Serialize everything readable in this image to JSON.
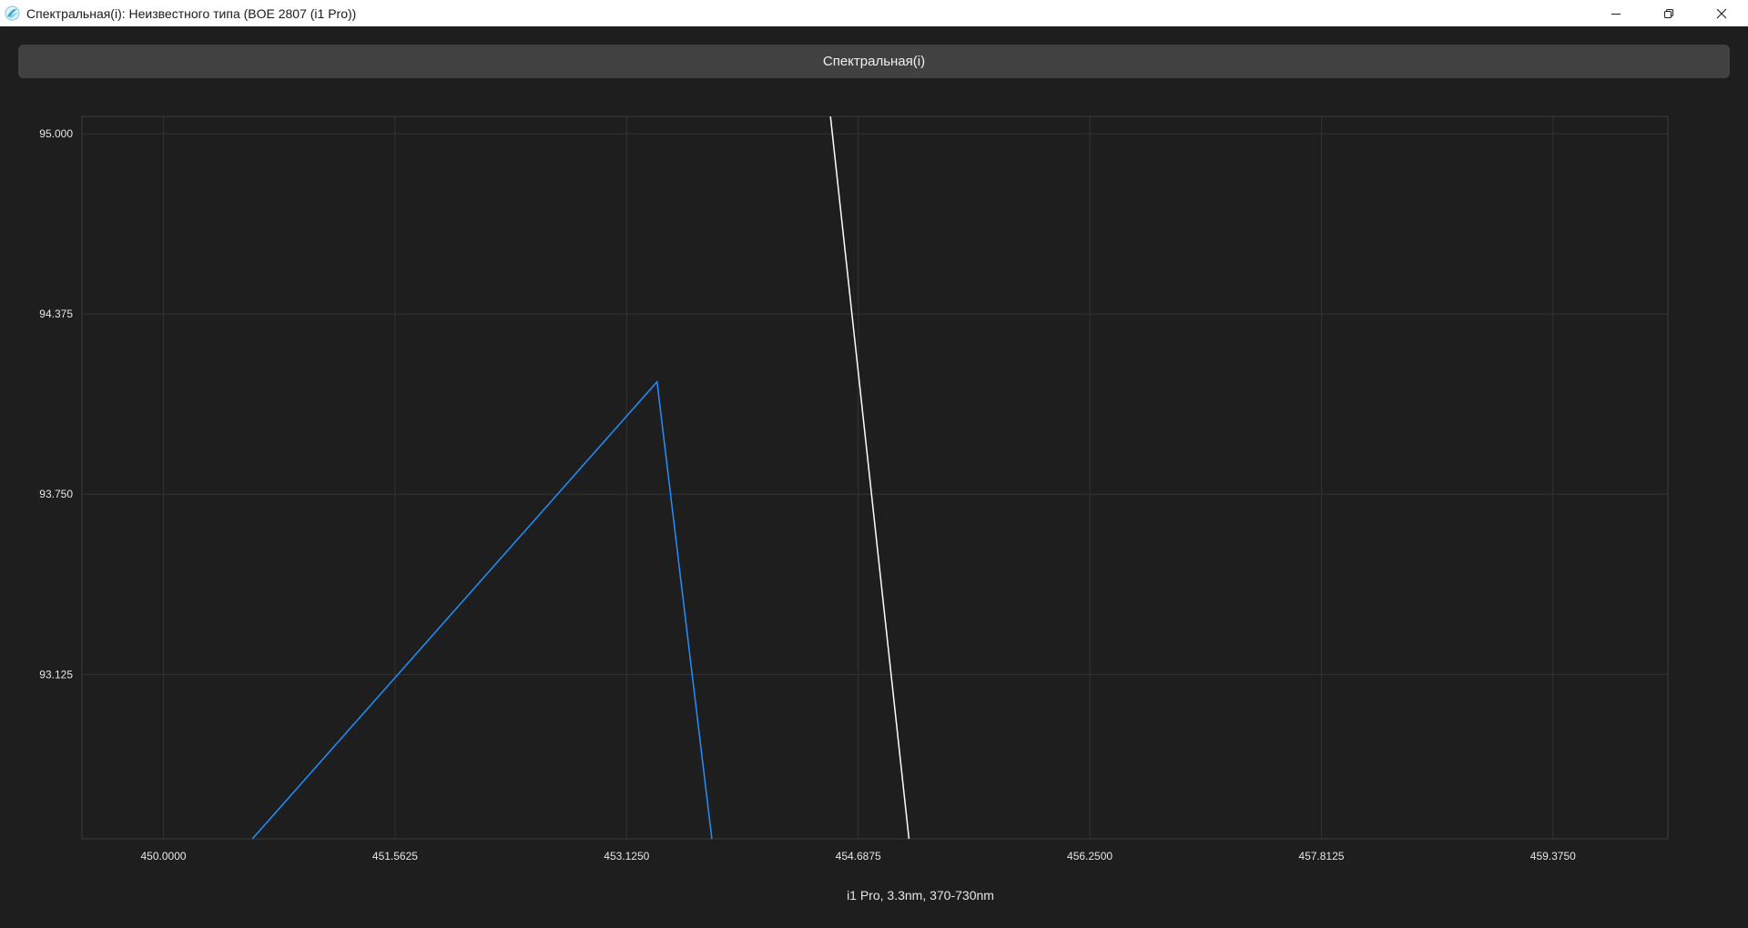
{
  "window": {
    "title": "Спектральная(i): Неизвестного типа (BOE 2807 (i1 Pro))",
    "icon": "app-logo-icon",
    "controls": [
      "minimize-icon",
      "restore-icon",
      "close-icon"
    ]
  },
  "header": {
    "label": "Спектральная(i)"
  },
  "chart_data": {
    "type": "line",
    "title": "",
    "xlabel": "i1 Pro, 3.3nm, 370-730nm",
    "ylabel": "",
    "xlim": [
      449.45,
      460.15
    ],
    "ylim": [
      92.555,
      95.06
    ],
    "x_ticks": [
      450.0,
      451.5625,
      453.125,
      454.6875,
      456.25,
      457.8125,
      459.375
    ],
    "x_tick_labels": [
      "450.0000",
      "451.5625",
      "453.1250",
      "454.6875",
      "456.2500",
      "457.8125",
      "459.3750"
    ],
    "y_ticks": [
      93.125,
      93.75,
      94.375,
      95.0
    ],
    "y_tick_labels": [
      "93.125",
      "93.750",
      "94.375",
      "95.000"
    ],
    "grid": true,
    "legend": "none",
    "series": [
      {
        "color": "#1e90ff",
        "points": [
          [
            450.6,
            92.555
          ],
          [
            453.33,
            94.14
          ],
          [
            453.7,
            92.555
          ]
        ]
      },
      {
        "color": "#ffffff",
        "points": [
          [
            454.5,
            95.06
          ],
          [
            455.03,
            92.555
          ]
        ]
      }
    ]
  }
}
